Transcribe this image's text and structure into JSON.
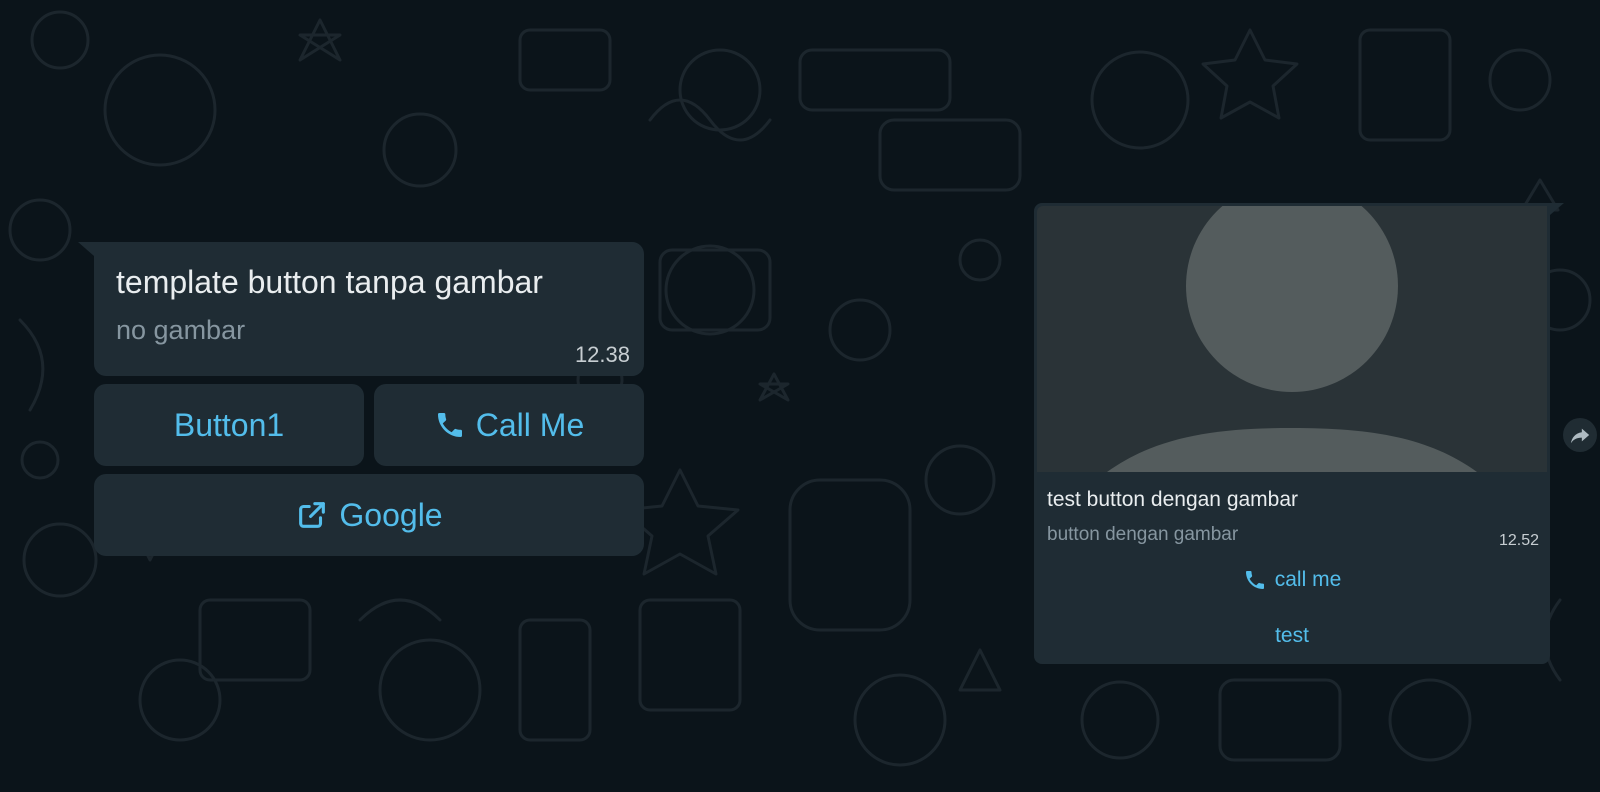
{
  "theme": {
    "background": "#0b141a",
    "bubble": "#1f2c34",
    "accent": "#53bdeb",
    "primary_text": "#e9edef",
    "secondary_text": "#8696a0"
  },
  "left_message": {
    "title": "template button tanpa gambar",
    "subtitle": "no gambar",
    "time": "12.38",
    "buttons": [
      {
        "label": "Button1",
        "icon": null
      },
      {
        "label": "Call Me",
        "icon": "phone-icon"
      },
      {
        "label": "Google",
        "icon": "external-link-icon"
      }
    ]
  },
  "right_message": {
    "image": "default-avatar-placeholder",
    "title": "test button dengan gambar",
    "subtitle": "button dengan gambar",
    "time": "12.52",
    "buttons": [
      {
        "label": "call me",
        "icon": "phone-icon"
      },
      {
        "label": "test",
        "icon": null
      }
    ]
  },
  "forward_button": {
    "icon": "forward-icon"
  }
}
